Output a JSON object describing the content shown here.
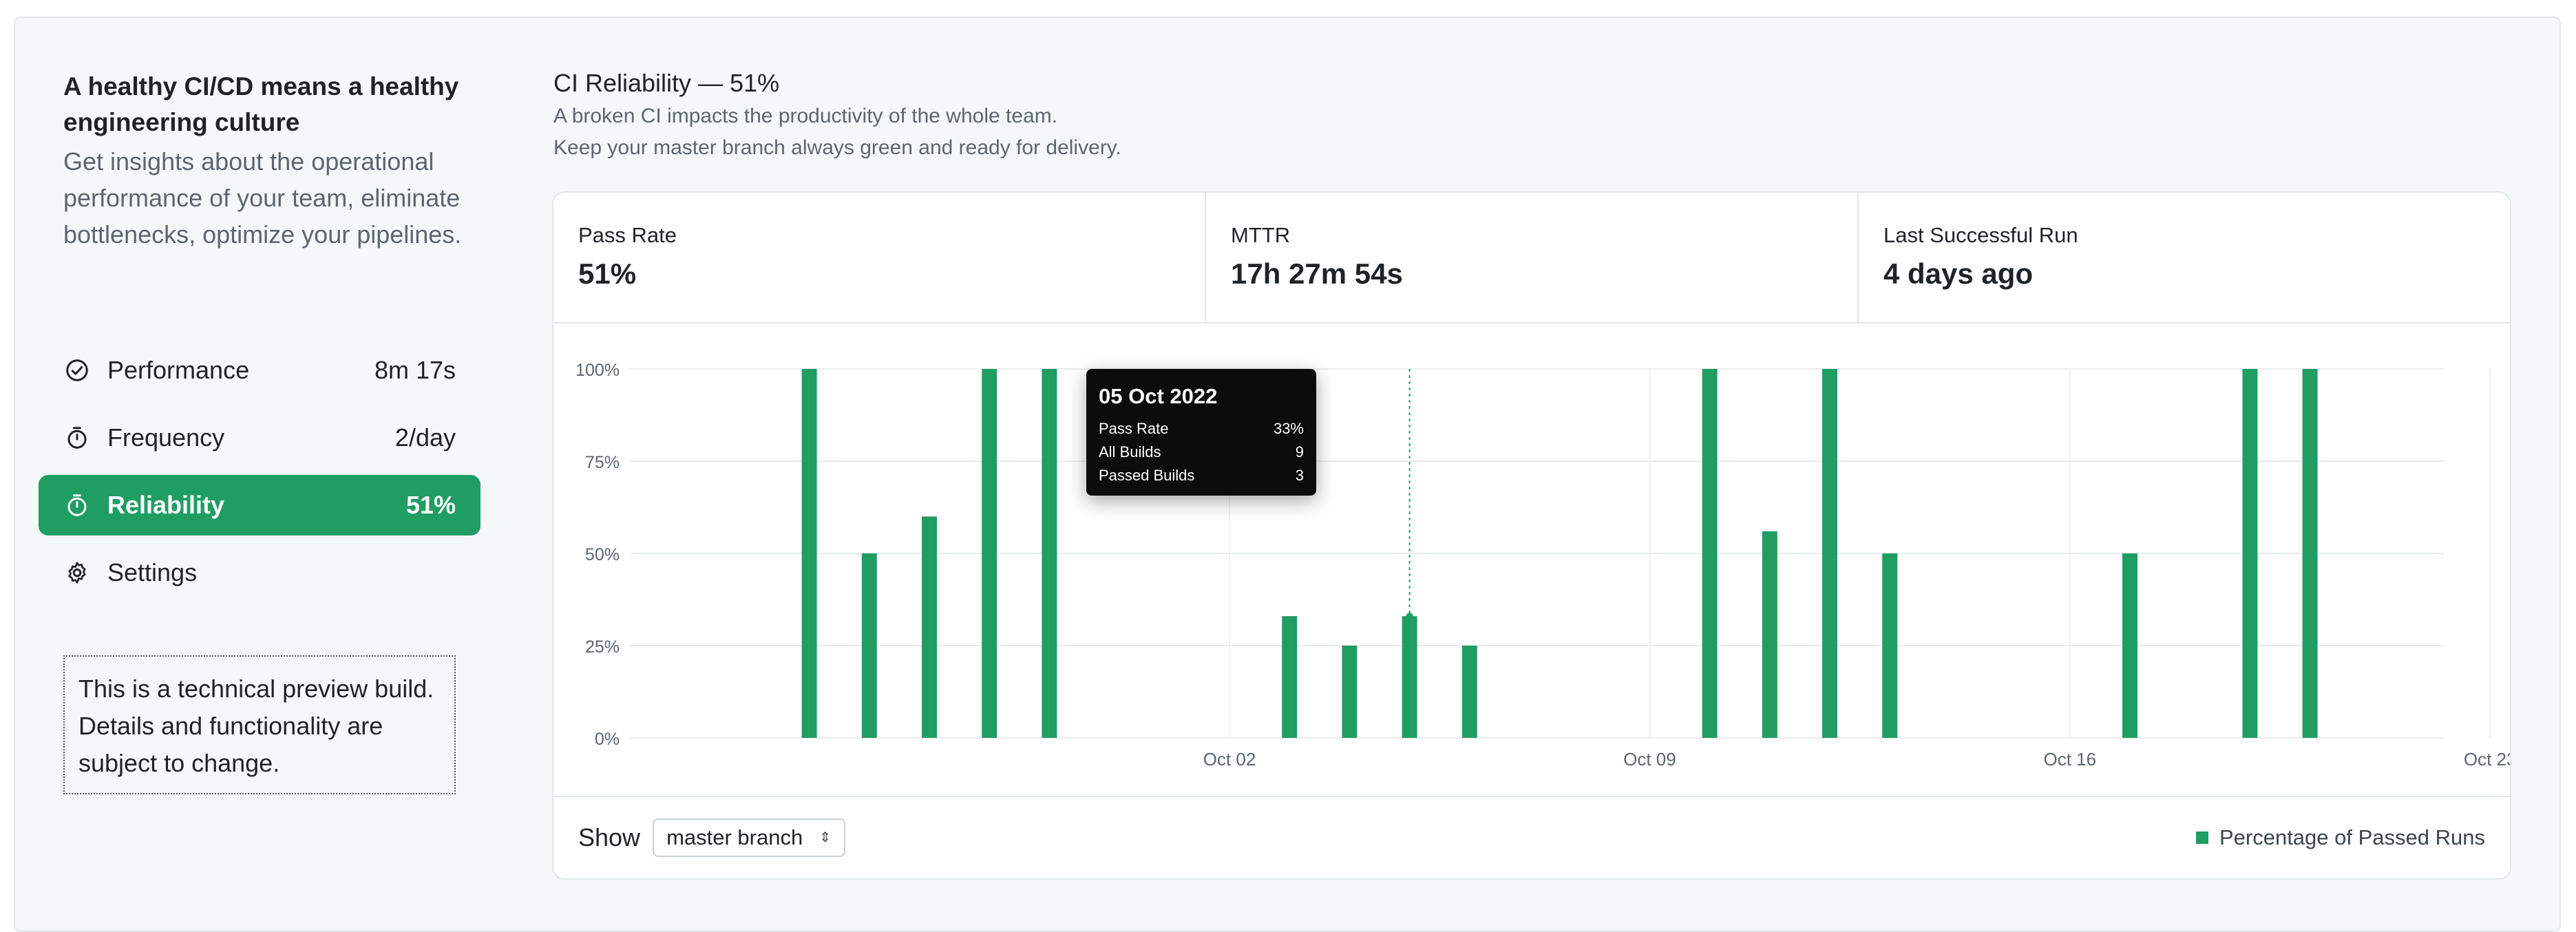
{
  "sidebar": {
    "heading": "A healthy CI/CD means a healthy engineering culture",
    "description": "Get insights about the operational performance of your team, eliminate bottlenecks, optimize your pipelines.",
    "items": [
      {
        "label": "Performance",
        "value": "8m 17s",
        "icon": "check-circle-icon"
      },
      {
        "label": "Frequency",
        "value": "2/day",
        "icon": "stopwatch-icon"
      },
      {
        "label": "Reliability",
        "value": "51%",
        "icon": "stopwatch-icon",
        "active": true
      },
      {
        "label": "Settings",
        "value": "",
        "icon": "gear-icon"
      }
    ],
    "notice": "This is a technical preview build. Details and functionality are subject to change."
  },
  "main": {
    "title": "CI Reliability — 51%",
    "subtitle_1": "A broken CI impacts the productivity of the whole team.",
    "subtitle_2": "Keep your master branch always green and ready for delivery."
  },
  "stats": [
    {
      "label": "Pass Rate",
      "value": "51%"
    },
    {
      "label": "MTTR",
      "value": "17h 27m 54s"
    },
    {
      "label": "Last Successful Run",
      "value": "4 days ago"
    }
  ],
  "tooltip": {
    "date": "05 Oct 2022",
    "rows": [
      {
        "label": "Pass Rate",
        "value": "33%"
      },
      {
        "label": "All Builds",
        "value": "9"
      },
      {
        "label": "Passed Builds",
        "value": "3"
      }
    ]
  },
  "footer": {
    "show_label": "Show",
    "branch": "master branch",
    "legend": "Percentage of Passed Runs"
  },
  "colors": {
    "accent": "#1f9d63"
  },
  "chart_data": {
    "type": "bar",
    "x_type": "date",
    "x_ticks": [
      "Oct 02",
      "Oct 09",
      "Oct 16",
      "Oct 23"
    ],
    "y_ticks": [
      "0%",
      "25%",
      "50%",
      "75%",
      "100%"
    ],
    "ylim": [
      0,
      100
    ],
    "series": [
      {
        "name": "Percentage of Passed Runs",
        "points": [
          {
            "x": "2022-09-25",
            "y": 100
          },
          {
            "x": "2022-09-26",
            "y": 50
          },
          {
            "x": "2022-09-27",
            "y": 60
          },
          {
            "x": "2022-09-28",
            "y": 100
          },
          {
            "x": "2022-09-29",
            "y": 100
          },
          {
            "x": "2022-10-03",
            "y": 33
          },
          {
            "x": "2022-10-04",
            "y": 25
          },
          {
            "x": "2022-10-05",
            "y": 33
          },
          {
            "x": "2022-10-06",
            "y": 25
          },
          {
            "x": "2022-10-10",
            "y": 100
          },
          {
            "x": "2022-10-11",
            "y": 56
          },
          {
            "x": "2022-10-12",
            "y": 100
          },
          {
            "x": "2022-10-13",
            "y": 50
          },
          {
            "x": "2022-10-17",
            "y": 50
          },
          {
            "x": "2022-10-19",
            "y": 100
          },
          {
            "x": "2022-10-20",
            "y": 100
          }
        ]
      }
    ],
    "highlight": "2022-10-05",
    "legend": "bottom-right",
    "grid": true
  }
}
